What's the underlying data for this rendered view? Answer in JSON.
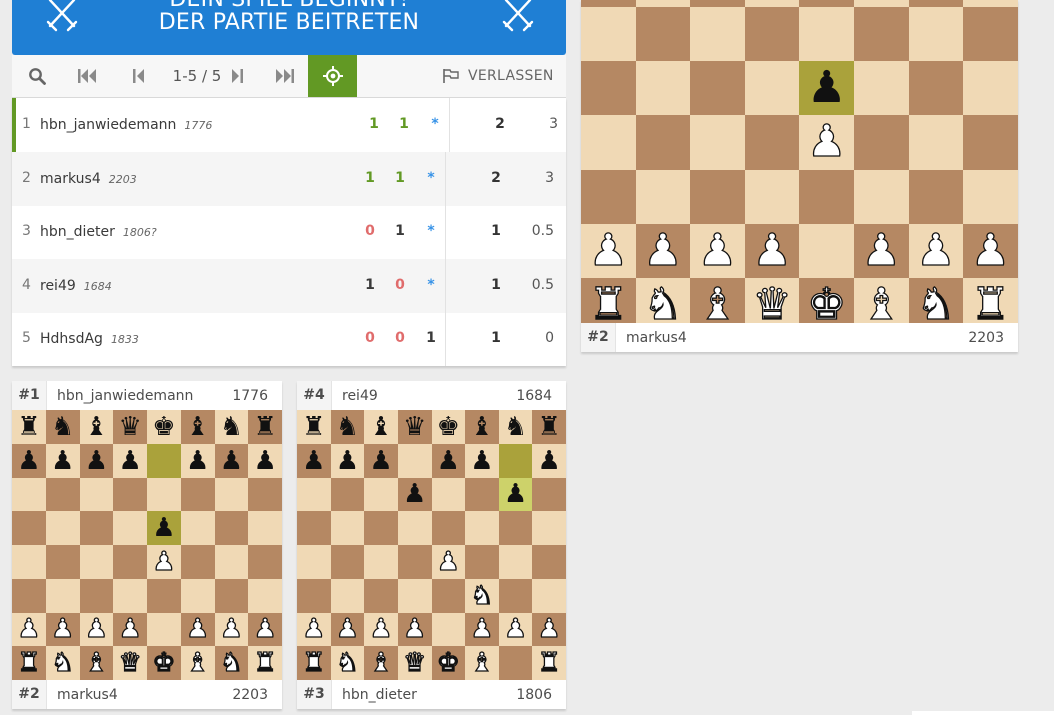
{
  "banner": {
    "line1": "DEIN SPIEL BEGINNT!",
    "line2": "DER PARTIE BEITRETEN",
    "bg_color": "#1f7fd4",
    "icon": "crossed-swords-icon"
  },
  "toolbar": {
    "page_label": "1-5 / 5",
    "leave_label": "VERLASSEN",
    "focus_color": "#629924"
  },
  "standings": [
    {
      "rank": "1",
      "name": "hbn_janwiedemann",
      "rating": "1776",
      "scores": [
        {
          "v": "1",
          "k": "win"
        },
        {
          "v": "1",
          "k": "win"
        },
        {
          "v": "*",
          "k": "star"
        }
      ],
      "points": "2",
      "perf": "3",
      "me": true
    },
    {
      "rank": "2",
      "name": "markus4",
      "rating": "2203",
      "scores": [
        {
          "v": "1",
          "k": "win"
        },
        {
          "v": "1",
          "k": "win"
        },
        {
          "v": "*",
          "k": "star"
        }
      ],
      "points": "2",
      "perf": "3"
    },
    {
      "rank": "3",
      "name": "hbn_dieter",
      "rating": "1806?",
      "scores": [
        {
          "v": "0",
          "k": "loss"
        },
        {
          "v": "1",
          "k": "draw"
        },
        {
          "v": "*",
          "k": "star"
        }
      ],
      "points": "1",
      "perf": "0.5"
    },
    {
      "rank": "4",
      "name": "rei49",
      "rating": "1684",
      "scores": [
        {
          "v": "1",
          "k": "draw"
        },
        {
          "v": "0",
          "k": "loss"
        },
        {
          "v": "*",
          "k": "star"
        }
      ],
      "points": "1",
      "perf": "0.5"
    },
    {
      "rank": "5",
      "name": "HdhsdAg",
      "rating": "1833",
      "scores": [
        {
          "v": "0",
          "k": "loss"
        },
        {
          "v": "0",
          "k": "loss"
        },
        {
          "v": "1",
          "k": "draw"
        }
      ],
      "points": "1",
      "perf": "0"
    }
  ],
  "big_board": {
    "bottom": {
      "num": "#2",
      "name": "markus4",
      "rating": "2203"
    },
    "rows": [
      "........",
      "....p...",
      "....P...",
      "........",
      "PPPP.PPP",
      "RNBQKBNR"
    ],
    "highlights": [
      [
        1,
        4
      ]
    ]
  },
  "mini_board_1": {
    "top": {
      "num": "#1",
      "name": "hbn_janwiedemann",
      "rating": "1776"
    },
    "bottom": {
      "num": "#2",
      "name": "markus4",
      "rating": "2203"
    },
    "rows": [
      "rnbqkbnr",
      "pppp.ppp",
      "........",
      "....p...",
      "....P...",
      "........",
      "PPPP.PPP",
      "RNBQKBNR"
    ],
    "highlights": [
      [
        1,
        4
      ],
      [
        3,
        4
      ]
    ],
    "highlights2": []
  },
  "mini_board_2": {
    "top": {
      "num": "#4",
      "name": "rei49",
      "rating": "1684"
    },
    "bottom": {
      "num": "#3",
      "name": "hbn_dieter",
      "rating": "1806"
    },
    "rows": [
      "rnbqkbnr",
      "ppp.pp.p",
      "...p..p.",
      "........",
      "....P...",
      ".....N..",
      "PPPP.PPP",
      "RNBQKB.R"
    ],
    "highlights": [
      [
        1,
        6
      ]
    ],
    "highlights2": [
      [
        2,
        6
      ]
    ]
  }
}
